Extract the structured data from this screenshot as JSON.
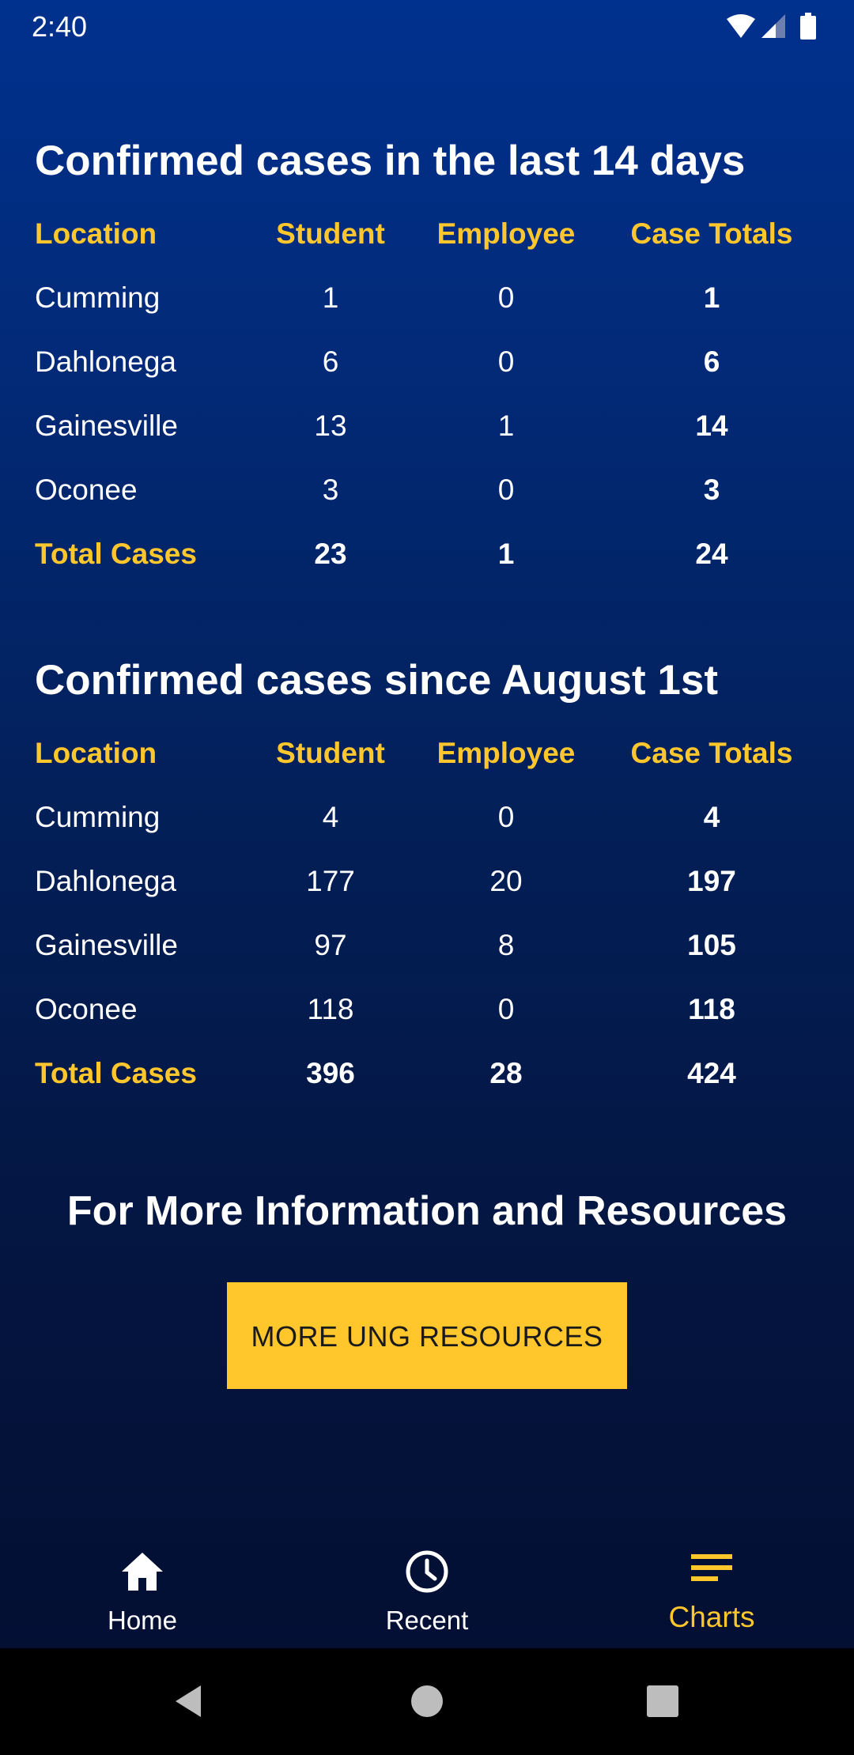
{
  "status_bar": {
    "time": "2:40"
  },
  "section_14_days": {
    "title": "Confirmed cases in the last 14 days",
    "headers": {
      "location": "Location",
      "student": "Student",
      "employee": "Employee",
      "totals": "Case Totals"
    },
    "rows": [
      {
        "location": "Cumming",
        "student": "1",
        "employee": "0",
        "total": "1"
      },
      {
        "location": "Dahlonega",
        "student": "6",
        "employee": "0",
        "total": "6"
      },
      {
        "location": "Gainesville",
        "student": "13",
        "employee": "1",
        "total": "14"
      },
      {
        "location": "Oconee",
        "student": "3",
        "employee": "0",
        "total": "3"
      }
    ],
    "total_row": {
      "location": "Total Cases",
      "student": "23",
      "employee": "1",
      "total": "24"
    }
  },
  "section_since_aug": {
    "title": "Confirmed cases since August 1st",
    "headers": {
      "location": "Location",
      "student": "Student",
      "employee": "Employee",
      "totals": "Case Totals"
    },
    "rows": [
      {
        "location": "Cumming",
        "student": "4",
        "employee": "0",
        "total": "4"
      },
      {
        "location": "Dahlonega",
        "student": "177",
        "employee": "20",
        "total": "197"
      },
      {
        "location": "Gainesville",
        "student": "97",
        "employee": "8",
        "total": "105"
      },
      {
        "location": "Oconee",
        "student": "118",
        "employee": "0",
        "total": "118"
      }
    ],
    "total_row": {
      "location": "Total Cases",
      "student": "396",
      "employee": "28",
      "total": "424"
    }
  },
  "more_info": {
    "title": "For More Information and Resources",
    "button_label": "MORE UNG RESOURCES"
  },
  "bottom_nav": {
    "items": [
      {
        "label": "Home",
        "icon": "home-icon"
      },
      {
        "label": "Recent",
        "icon": "clock-icon"
      },
      {
        "label": "Charts",
        "icon": "menu-lines-icon",
        "active": true
      }
    ]
  },
  "colors": {
    "accent": "#ffc72c",
    "background_top": "#00318e",
    "background_bottom": "#030f33"
  }
}
